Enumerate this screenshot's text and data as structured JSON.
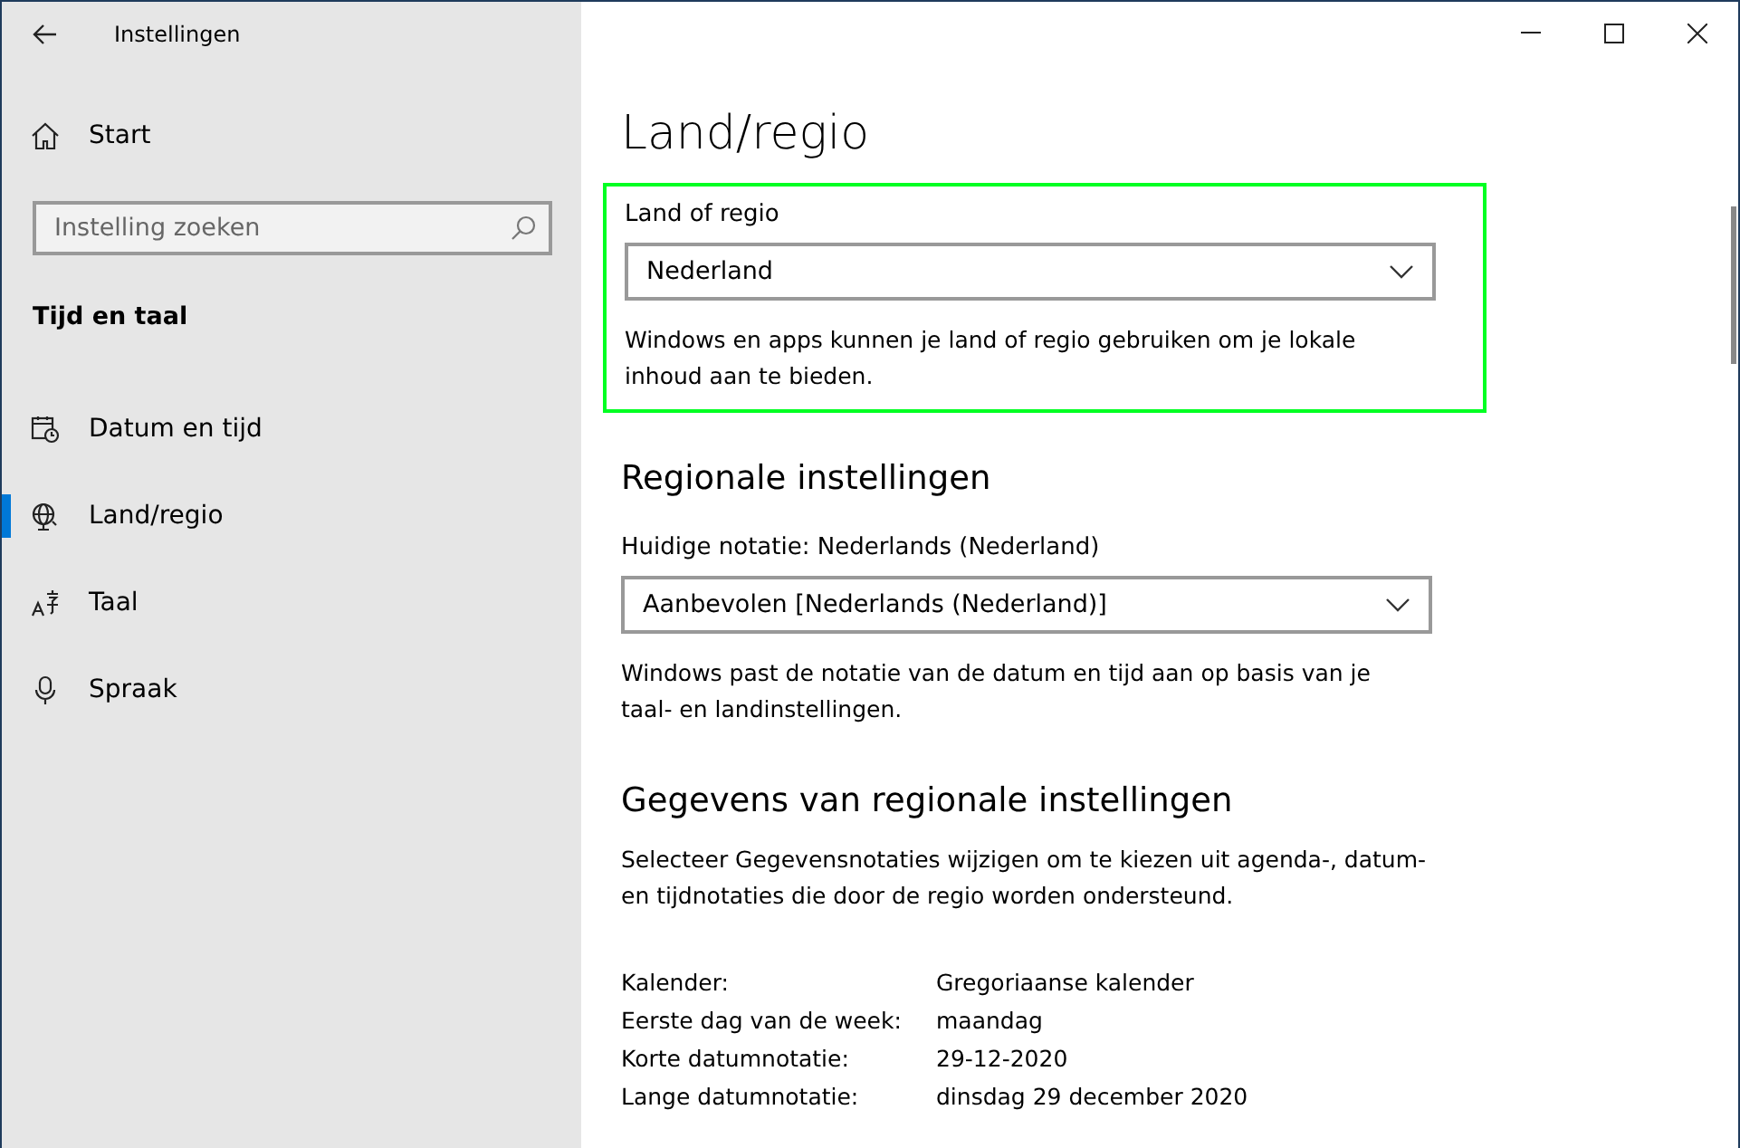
{
  "window": {
    "title": "Instellingen"
  },
  "sidebar": {
    "home": "Start",
    "search": {
      "placeholder": "Instelling zoeken"
    },
    "section": "Tijd en taal",
    "items": [
      {
        "kind": "clock",
        "label": "Datum en tijd",
        "selected": false
      },
      {
        "kind": "globe",
        "label": "Land/regio",
        "selected": true
      },
      {
        "kind": "language",
        "label": "Taal",
        "selected": false
      },
      {
        "kind": "mic",
        "label": "Spraak",
        "selected": false
      }
    ]
  },
  "page": {
    "title": "Land/regio",
    "country": {
      "label": "Land of regio",
      "value": "Nederland",
      "description": "Windows en apps kunnen je land of regio gebruiken om je lokale inhoud aan te bieden.",
      "highlighted": true
    },
    "regional": {
      "heading": "Regionale instellingen",
      "label": "Huidige notatie: Nederlands (Nederland)",
      "value": "Aanbevolen [Nederlands (Nederland)]",
      "description": "Windows past de notatie van de datum en tijd aan op basis van je taal- en landinstellingen."
    },
    "data": {
      "heading": "Gegevens van regionale instellingen",
      "description": "Selecteer Gegevensnotaties wijzigen om te kiezen uit agenda-, datum- en tijdnotaties die door de regio worden ondersteund.",
      "rows": [
        {
          "label": "Kalender:",
          "value": "Gregoriaanse kalender"
        },
        {
          "label": "Eerste dag van de week:",
          "value": "maandag"
        },
        {
          "label": "Korte datumnotatie:",
          "value": "29-12-2020"
        },
        {
          "label": "Lange datumnotatie:",
          "value": "dinsdag 29 december 2020"
        }
      ]
    }
  }
}
